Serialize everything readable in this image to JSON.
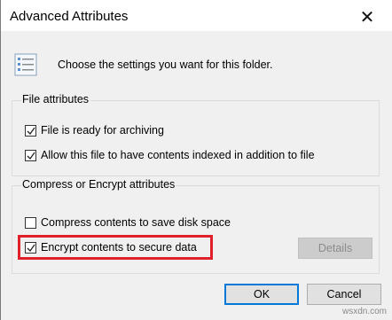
{
  "window": {
    "title": "Advanced Attributes",
    "close_glyph": "✕"
  },
  "intro_text": "Choose the settings you want for this folder.",
  "file_attributes": {
    "legend": "File attributes",
    "options": [
      {
        "label": "File is ready for archiving",
        "checked": true
      },
      {
        "label": "Allow this file to have contents indexed in addition to file",
        "checked": true
      }
    ]
  },
  "compress_encrypt": {
    "legend": "Compress or Encrypt attributes",
    "options": [
      {
        "label": "Compress contents to save disk space",
        "checked": false
      },
      {
        "label": "Encrypt contents to secure data",
        "checked": true
      }
    ],
    "details_label": "Details"
  },
  "buttons": {
    "ok": "OK",
    "cancel": "Cancel"
  },
  "watermark": "wsxdn.com",
  "colors": {
    "highlight": "#e0202a",
    "accent": "#0078d7"
  }
}
